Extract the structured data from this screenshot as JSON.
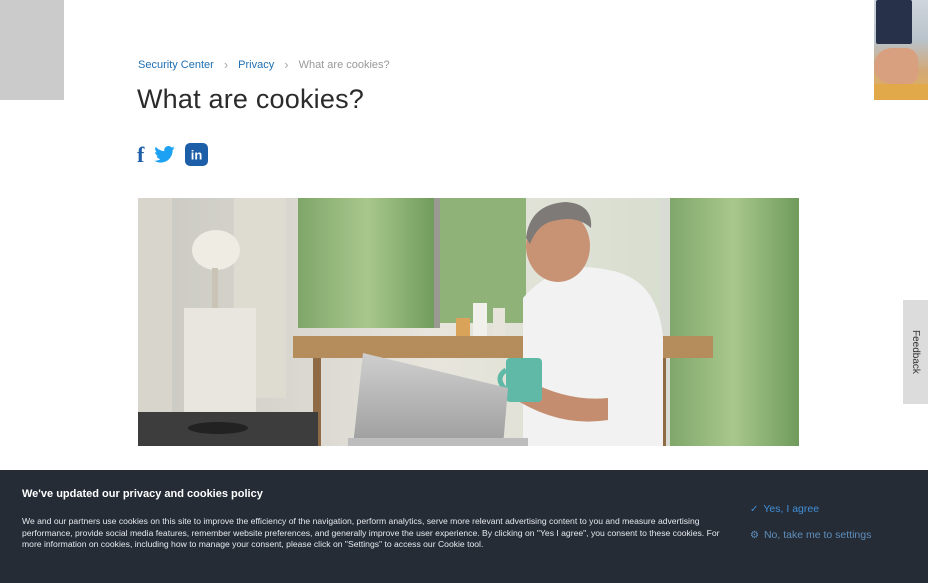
{
  "breadcrumb": {
    "items": [
      "Security Center",
      "Privacy"
    ],
    "current": "What are cookies?"
  },
  "page": {
    "title": "What are cookies?"
  },
  "share": {
    "icons": [
      "facebook-icon",
      "twitter-icon",
      "linkedin-icon"
    ],
    "linkedin_label": "in",
    "facebook_label": "f"
  },
  "feedback": {
    "label": "Feedback"
  },
  "cookie_banner": {
    "title": "We've updated our privacy and cookies policy",
    "body": "We and our partners use cookies on this site to improve the efficiency of the navigation, perform analytics, serve more relevant advertising content to you and measure advertising performance, provide social media features, remember website preferences, and generally improve the user experience. By clicking on \"Yes I agree\", you consent to these cookies. For more information on cookies, including how to manage your consent, please click on \"Settings\" to access our Cookie tool.",
    "agree_label": "Yes, I agree",
    "settings_label": "No, take me to settings"
  },
  "colors": {
    "link": "#1f6fb2",
    "banner_bg": "#262c36",
    "agree": "#3f8fd8",
    "facebook": "#1d5ea8",
    "twitter": "#1da1f2",
    "linkedin": "#1d5ea8"
  }
}
